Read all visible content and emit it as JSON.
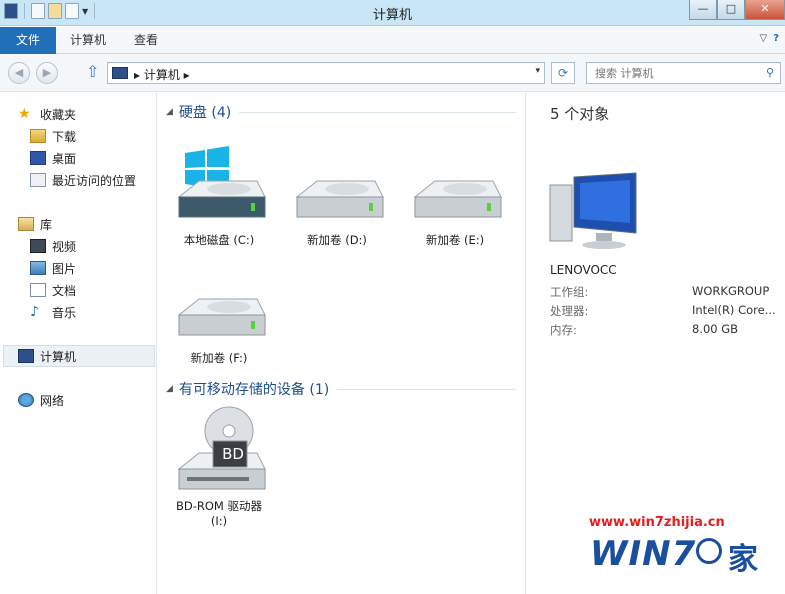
{
  "window": {
    "title": "计算机",
    "buttons": {
      "minimize": "—",
      "maximize": "□",
      "close": "✕"
    }
  },
  "ribbon": {
    "file_tab": "文件",
    "tabs": [
      "计算机",
      "查看"
    ],
    "help_glyph": "?"
  },
  "navigation": {
    "back_glyph": "◀",
    "forward_glyph": "▶",
    "up_glyph": "⇧",
    "breadcrumb": "▸ 计算机 ▸",
    "dropdown_glyph": "▾",
    "refresh_glyph": "⟳",
    "search_placeholder": "搜索 计算机",
    "search_glyph": "⚲"
  },
  "sidebar": {
    "favorites": {
      "label": "收藏夹",
      "items": [
        "下载",
        "桌面",
        "最近访问的位置"
      ]
    },
    "libraries": {
      "label": "库",
      "items": [
        "视频",
        "图片",
        "文档",
        "音乐"
      ]
    },
    "computer": "计算机",
    "network": "网络"
  },
  "content": {
    "hard_disks_header": "硬盘 (4)",
    "drives": [
      {
        "label": "本地磁盘 (C:)",
        "system": true
      },
      {
        "label": "新加卷 (D:)",
        "system": false
      },
      {
        "label": "新加卷 (E:)",
        "system": false
      },
      {
        "label": "新加卷 (F:)",
        "system": false
      }
    ],
    "removable_header": "有可移动存储的设备 (1)",
    "removable": [
      {
        "label_line1": "BD-ROM 驱动器",
        "label_line2": "(I:)",
        "badge": "BD"
      }
    ]
  },
  "details": {
    "count": "5 个对象",
    "computer_name": "LENOVOCC",
    "properties": [
      {
        "name": "工作组:",
        "value": "WORKGROUP"
      },
      {
        "name": "处理器:",
        "value": "Intel(R) Core..."
      },
      {
        "name": "内存:",
        "value": "8.00 GB"
      }
    ]
  },
  "watermark": {
    "url": "www.win7zhijia.cn",
    "logo_text": "WIN7",
    "logo_suffix": "家"
  },
  "colors": {
    "file_tab": "#1f6fb9",
    "titlebar": "#c9e6f6",
    "group_header": "#1f4e8f",
    "watermark_red": "#e02020",
    "watermark_blue": "#1a4f9e"
  }
}
